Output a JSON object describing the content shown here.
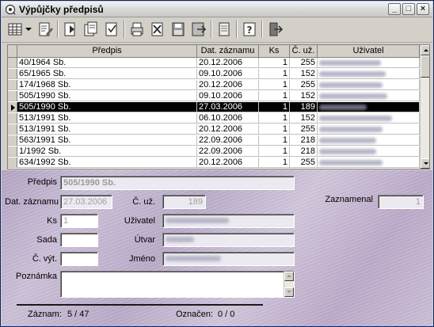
{
  "window": {
    "title": "Výpůjčky předpisů"
  },
  "titlebar_buttons": {
    "minimize": "_",
    "maximize": "□",
    "close": "×"
  },
  "grid": {
    "columns": [
      "Předpis",
      "Dat. záznamu",
      "Ks",
      "Č. už.",
      "Uživatel"
    ],
    "rows": [
      {
        "predpis": "40/1964 Sb.",
        "datum": "20.12.2006",
        "ks": "1",
        "cuz": "255"
      },
      {
        "predpis": "65/1965 Sb.",
        "datum": "09.10.2006",
        "ks": "1",
        "cuz": "152"
      },
      {
        "predpis": "174/1968 Sb.",
        "datum": "20.12.2006",
        "ks": "1",
        "cuz": "255"
      },
      {
        "predpis": "505/1990 Sb.",
        "datum": "09.10.2006",
        "ks": "1",
        "cuz": "152"
      },
      {
        "predpis": "505/1990 Sb.",
        "datum": "27.03.2006",
        "ks": "1",
        "cuz": "189",
        "selected": true
      },
      {
        "predpis": "513/1991 Sb.",
        "datum": "06.10.2006",
        "ks": "1",
        "cuz": "152"
      },
      {
        "predpis": "513/1991 Sb.",
        "datum": "20.12.2006",
        "ks": "1",
        "cuz": "255"
      },
      {
        "predpis": "563/1991 Sb.",
        "datum": "22.09.2006",
        "ks": "1",
        "cuz": "218"
      },
      {
        "predpis": "1/1992 Sb.",
        "datum": "22.09.2006",
        "ks": "1",
        "cuz": "218"
      },
      {
        "predpis": "634/1992 Sb.",
        "datum": "20.12.2006",
        "ks": "1",
        "cuz": "255"
      }
    ]
  },
  "form": {
    "predpis_label": "Předpis",
    "predpis_value": "505/1990 Sb.",
    "dat_label": "Dat. záznamu",
    "dat_value": "27.03.2006",
    "cuz_label": "Č. už.",
    "cuz_value": "189",
    "zaznamenal_label": "Zaznamenal",
    "zaznamenal_value": "1",
    "ks_label": "Ks",
    "ks_value": "1",
    "uzivatel_label": "Uživatel",
    "sada_label": "Sada",
    "utvar_label": "Útvar",
    "cvyt_label": "Č. výt.",
    "jmeno_label": "Jméno",
    "poznamka_label": "Poznámka"
  },
  "status": {
    "zaznam_label": "Záznam:",
    "zaznam_value": "5 / 47",
    "oznaceno_label": "Označen:",
    "oznaceno_value": "0 / 0"
  },
  "colors": {
    "selection": "#000000",
    "panel": "#c3b5d1",
    "titlebar": "#dcdcdc"
  }
}
